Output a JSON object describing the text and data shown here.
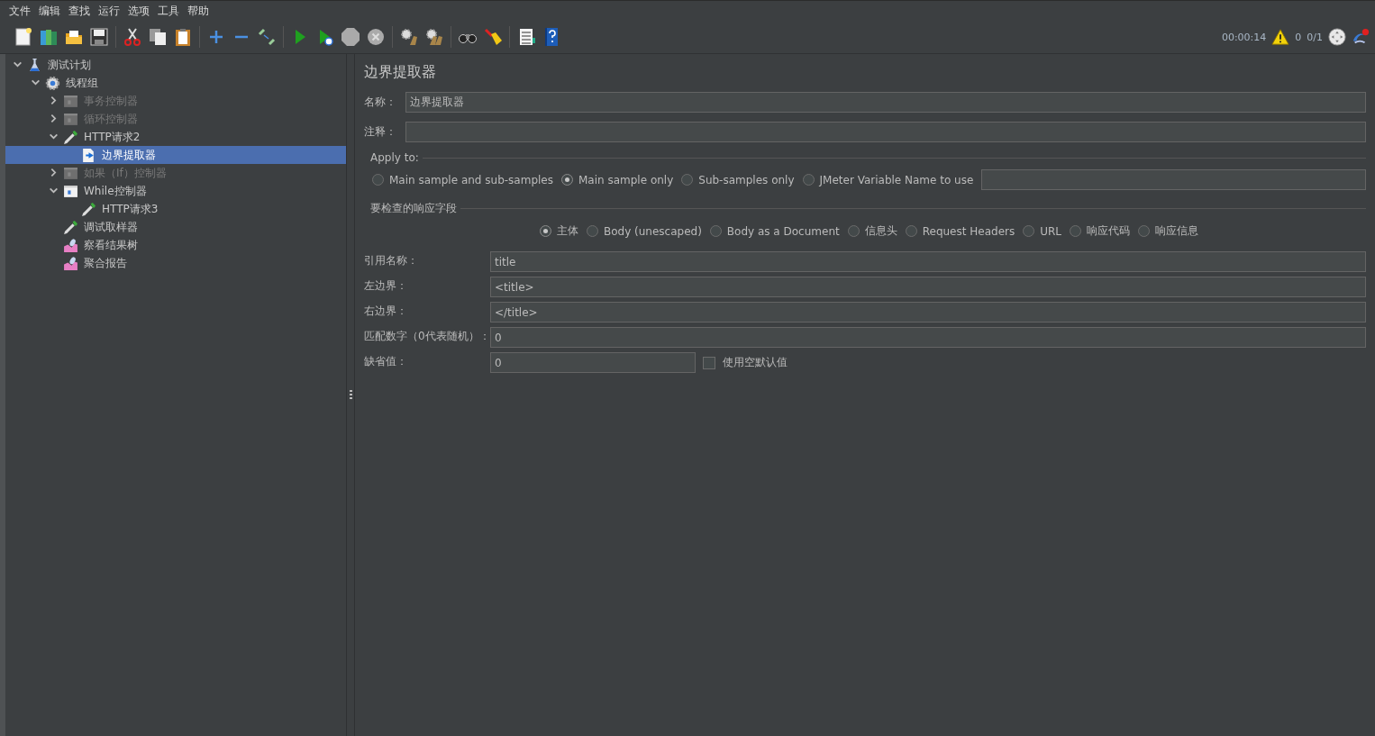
{
  "menu": [
    "文件",
    "编辑",
    "查找",
    "运行",
    "选项",
    "工具",
    "帮助"
  ],
  "status": {
    "elapsed": "00:00:14",
    "warnings": "0",
    "threads": "0/1"
  },
  "tree": [
    {
      "label": "测试计划",
      "kind": "plan",
      "expanded": true,
      "selected": false,
      "disabled": false,
      "children": [
        {
          "label": "线程组",
          "kind": "threads",
          "expanded": true,
          "selected": false,
          "disabled": false,
          "children": [
            {
              "label": "事务控制器",
              "kind": "controller",
              "expanded": false,
              "selected": false,
              "disabled": true
            },
            {
              "label": "循环控制器",
              "kind": "controller",
              "expanded": false,
              "selected": false,
              "disabled": true
            },
            {
              "label": "HTTP请求2",
              "kind": "sampler",
              "expanded": true,
              "selected": false,
              "disabled": false,
              "children": [
                {
                  "label": "边界提取器",
                  "kind": "extractor",
                  "selected": true,
                  "disabled": false
                }
              ]
            },
            {
              "label": "如果（If）控制器",
              "kind": "controller",
              "expanded": false,
              "selected": false,
              "disabled": true
            },
            {
              "label": "While控制器",
              "kind": "controller",
              "expanded": true,
              "selected": false,
              "disabled": false,
              "children": [
                {
                  "label": "HTTP请求3",
                  "kind": "sampler",
                  "selected": false,
                  "disabled": false
                }
              ]
            },
            {
              "label": "调试取样器",
              "kind": "sampler",
              "selected": false,
              "disabled": false
            },
            {
              "label": "察看结果树",
              "kind": "listener",
              "selected": false,
              "disabled": false
            },
            {
              "label": "聚合报告",
              "kind": "listener",
              "selected": false,
              "disabled": false
            }
          ]
        }
      ]
    }
  ],
  "editor": {
    "title": "边界提取器",
    "name": {
      "label": "名称：",
      "value": "边界提取器"
    },
    "comment": {
      "label": "注释："
    },
    "apply_to": {
      "legend": "Apply to:",
      "options": [
        {
          "label": "Main sample and sub-samples",
          "selected": false
        },
        {
          "label": "Main sample only",
          "selected": true
        },
        {
          "label": "Sub-samples only",
          "selected": false
        },
        {
          "label": "JMeter Variable Name to use",
          "selected": false
        }
      ]
    },
    "response_field": {
      "legend": "要检查的响应字段",
      "options": [
        {
          "label": "主体",
          "selected": true
        },
        {
          "label": "Body (unescaped)",
          "selected": false
        },
        {
          "label": "Body as a Document",
          "selected": false
        },
        {
          "label": "信息头",
          "selected": false
        },
        {
          "label": "Request Headers",
          "selected": false
        },
        {
          "label": "URL",
          "selected": false
        },
        {
          "label": "响应代码",
          "selected": false
        },
        {
          "label": "响应信息",
          "selected": false
        }
      ]
    },
    "params": [
      {
        "label": "引用名称：",
        "value": "title",
        "kind": "full"
      },
      {
        "label": "左边界：",
        "value": "<title>",
        "kind": "full"
      },
      {
        "label": "右边界：",
        "value": "</title>",
        "kind": "full"
      },
      {
        "label": "匹配数字（0代表随机）：",
        "value": "0",
        "kind": "full"
      },
      {
        "label": "缺省值：",
        "value": "0",
        "kind": "short"
      }
    ],
    "use_empty_default": {
      "label": "使用空默认值",
      "checked": false
    }
  }
}
